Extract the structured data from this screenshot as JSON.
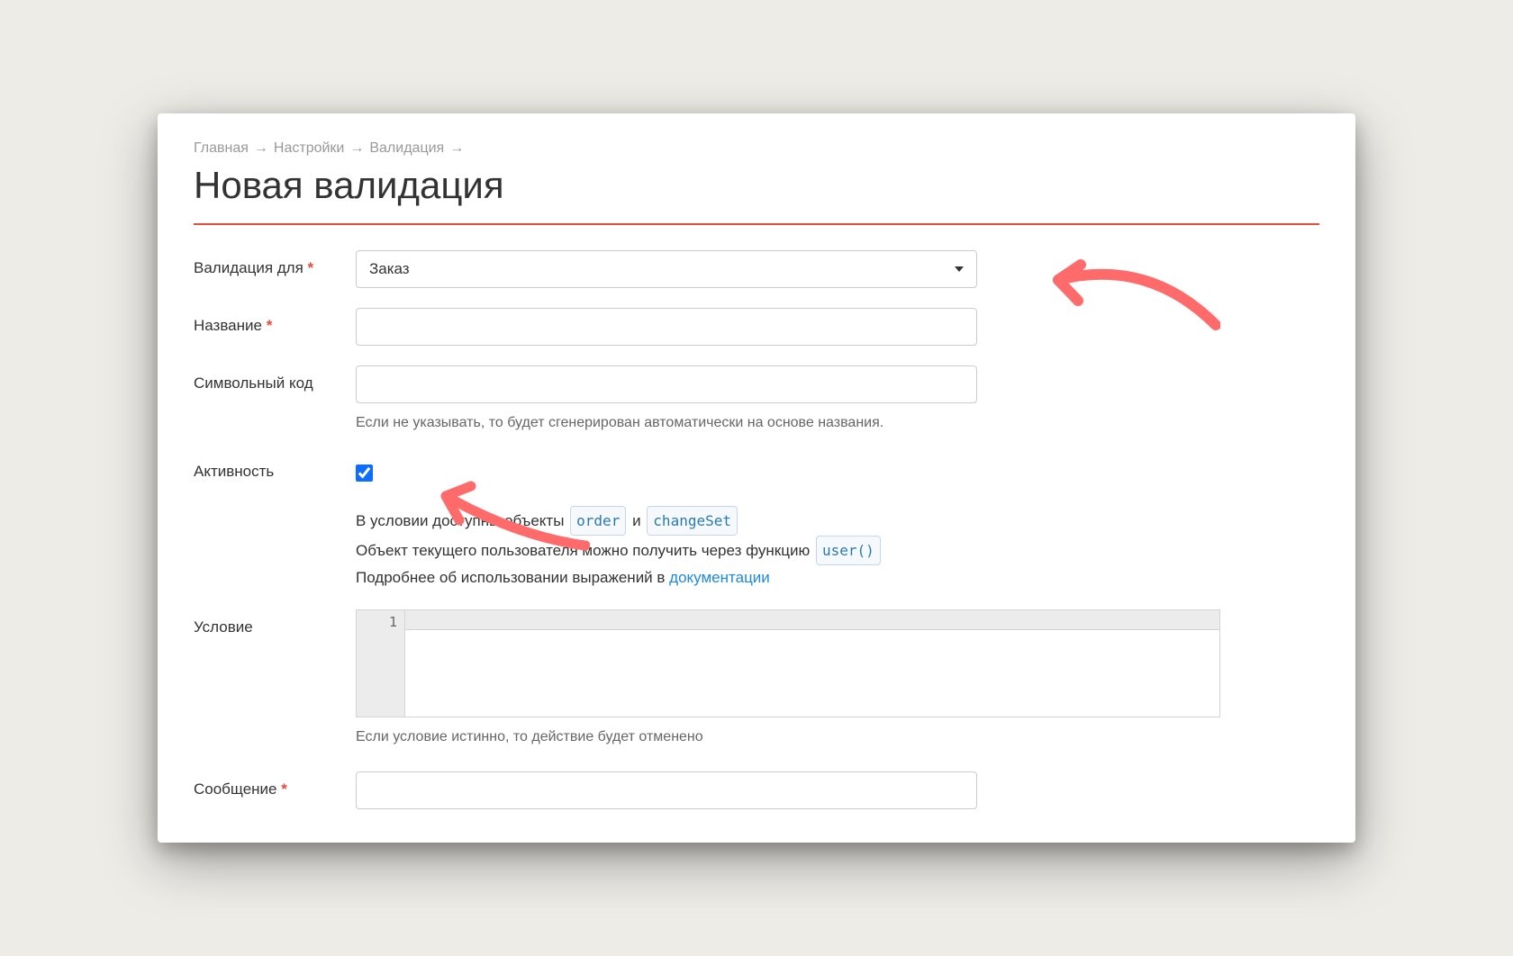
{
  "breadcrumb": {
    "home": "Главная",
    "settings": "Настройки",
    "validation": "Валидация",
    "sep": "→"
  },
  "page": {
    "title": "Новая валидация"
  },
  "form": {
    "validation_for": {
      "label": "Валидация для",
      "value": "Заказ"
    },
    "name": {
      "label": "Название",
      "value": ""
    },
    "code": {
      "label": "Символьный код",
      "value": "",
      "help": "Если не указывать, то будет сгенерирован автоматически на основе названия."
    },
    "active": {
      "label": "Активность",
      "checked": true
    },
    "condition": {
      "label": "Условие",
      "line_number": "1",
      "help": "Если условие истинно, то действие будет отменено"
    },
    "message": {
      "label": "Сообщение",
      "value": ""
    }
  },
  "info": {
    "line1_prefix": "В условии доступны объекты",
    "token_order": "order",
    "line1_and": "и",
    "token_changeset": "changeSet",
    "line2_prefix": "Объект текущего пользователя можно получить через функцию",
    "token_user": "user()",
    "line3_prefix": "Подробнее об использовании выражений в",
    "doc_link": "документации"
  }
}
